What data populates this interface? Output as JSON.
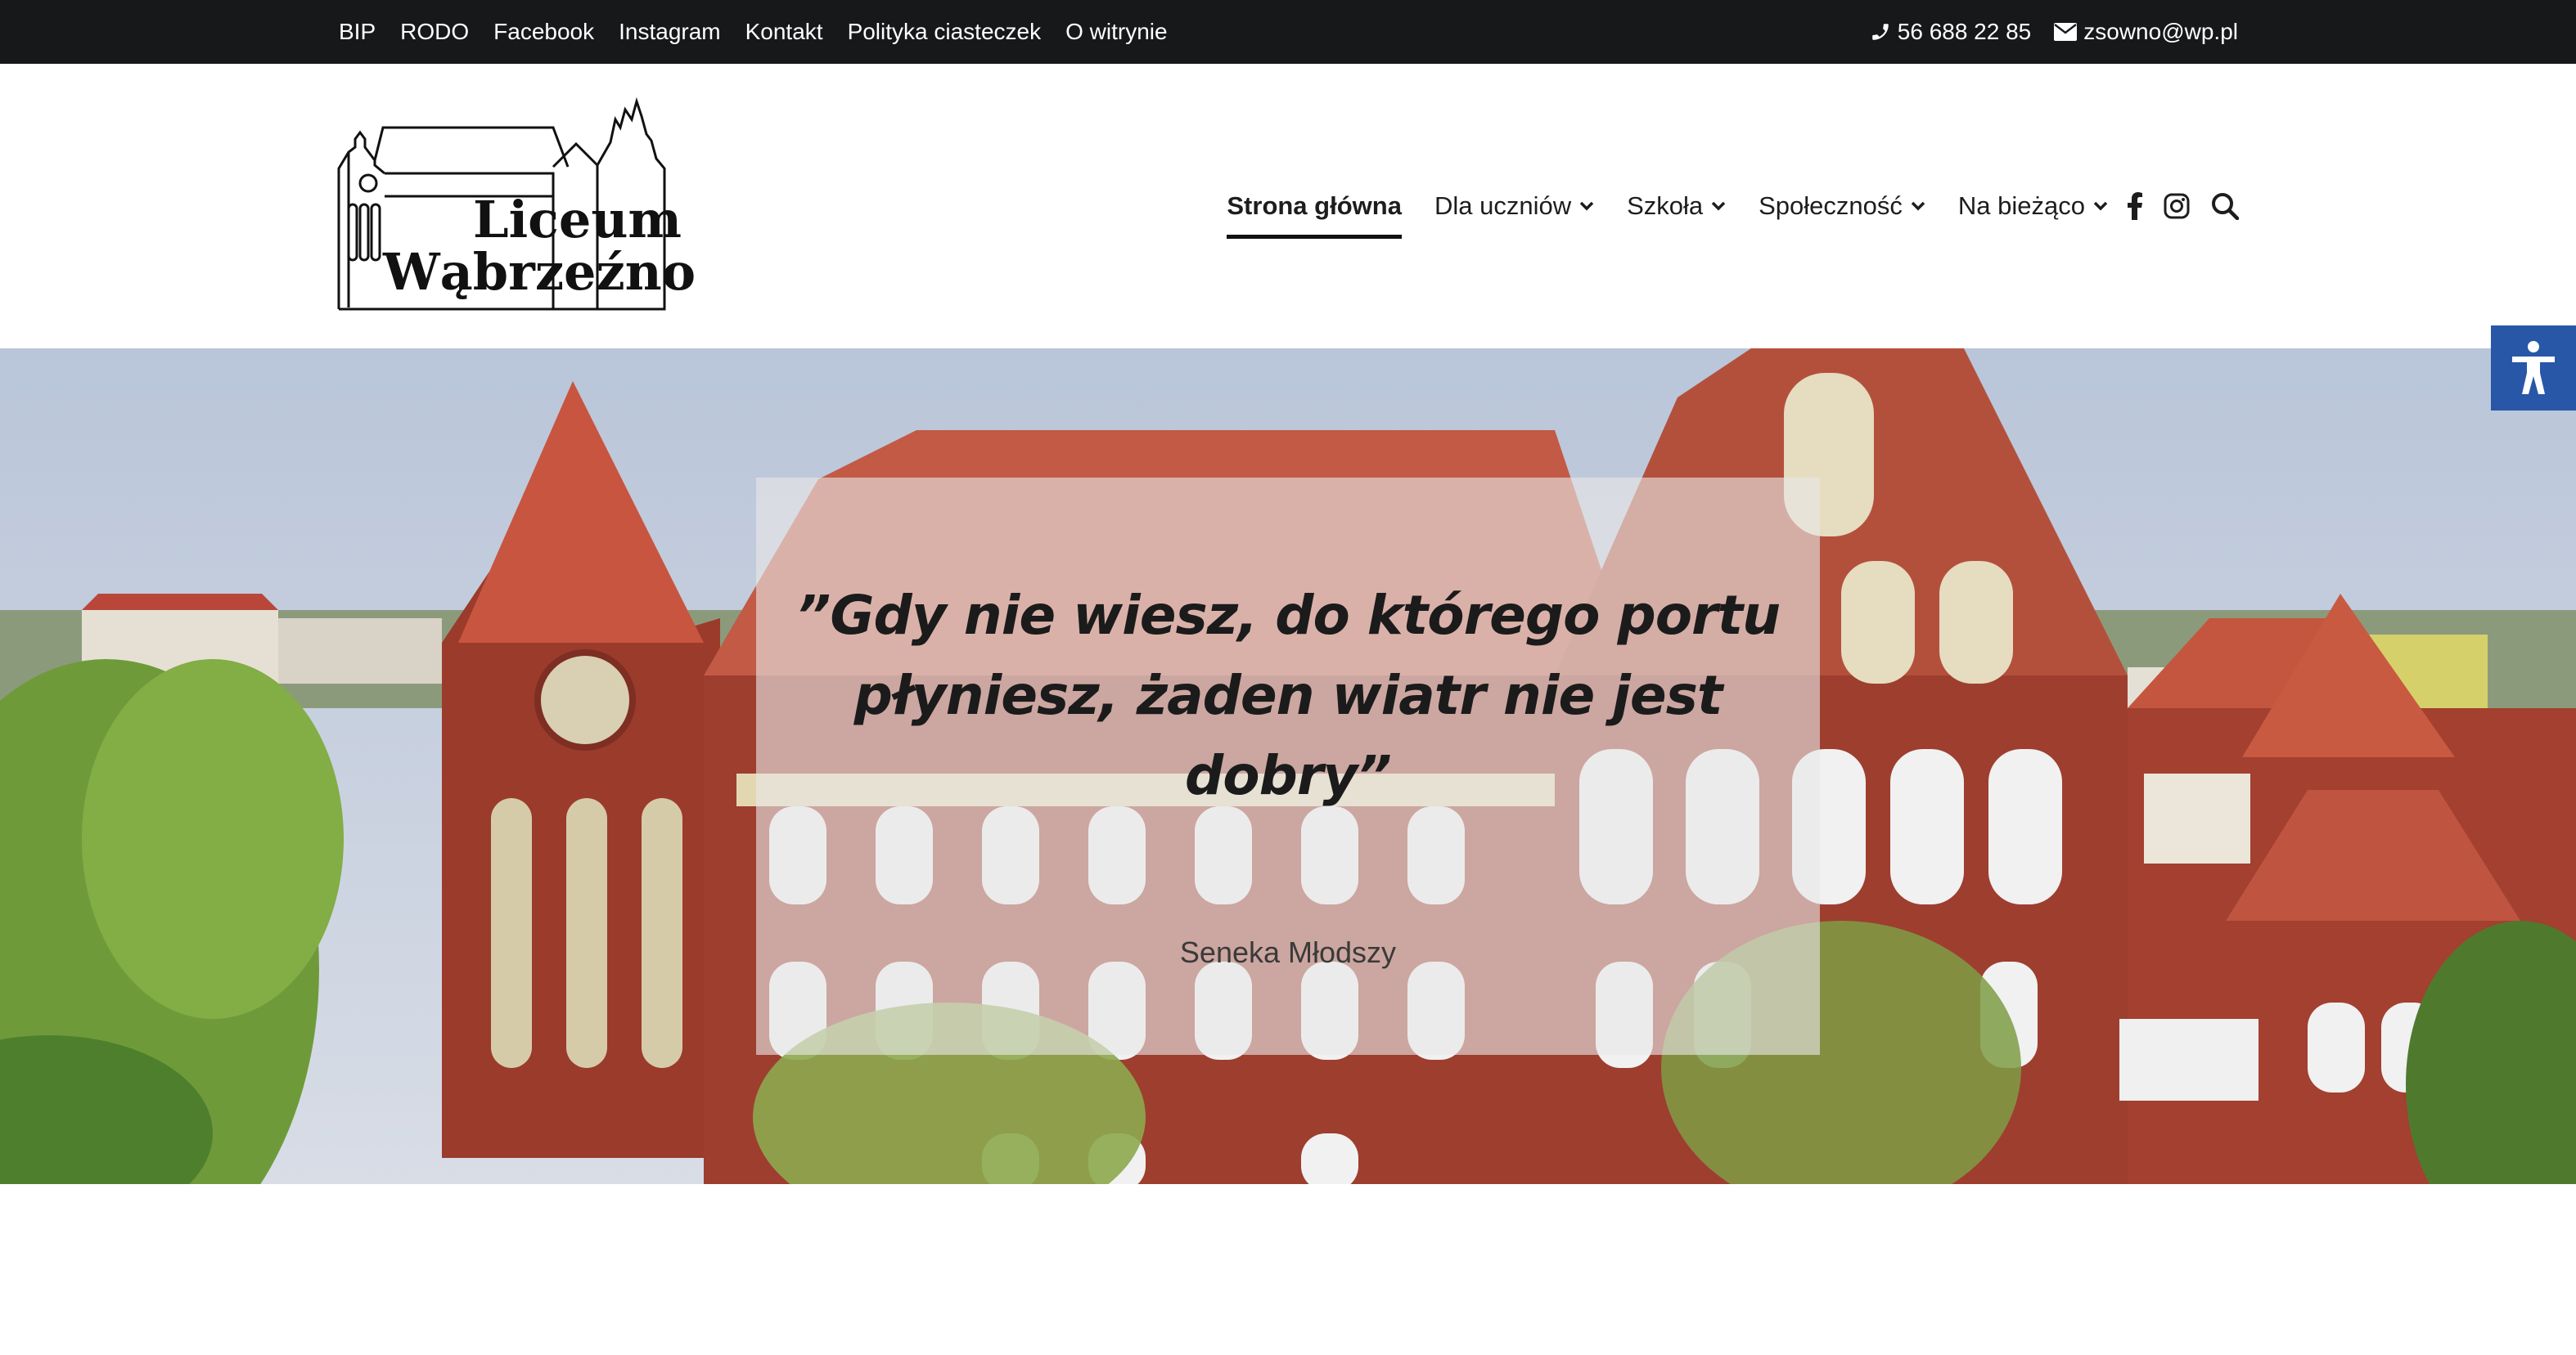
{
  "topbar": {
    "links": [
      "BIP",
      "RODO",
      "Facebook",
      "Instagram",
      "Kontakt",
      "Polityka ciasteczek",
      "O witrynie"
    ],
    "phone": "56 688 22 85",
    "email": "zsowno@wp.pl",
    "phone_icon": "phone-icon",
    "email_icon": "envelope-icon"
  },
  "logo": {
    "line1": "Liceum",
    "line2": "Wąbrzeźno"
  },
  "nav": {
    "items": [
      {
        "label": "Strona główna",
        "active": true,
        "dropdown": false
      },
      {
        "label": "Dla uczniów",
        "active": false,
        "dropdown": true
      },
      {
        "label": "Szkoła",
        "active": false,
        "dropdown": true
      },
      {
        "label": "Społeczność",
        "active": false,
        "dropdown": true
      },
      {
        "label": "Na bieżąco",
        "active": false,
        "dropdown": true
      }
    ],
    "icons": [
      "facebook-icon",
      "instagram-icon",
      "search-icon"
    ]
  },
  "accessibility": {
    "icon": "accessibility-icon",
    "color": "#2857a8"
  },
  "hero": {
    "quote_line1": "”Gdy nie wiesz, do którego portu",
    "quote_line2": "płyniesz, żaden wiatr nie jest dobry”",
    "author": "Seneka Młodszy"
  },
  "colors": {
    "topbar_bg": "#17181a",
    "brick": "#9b3b2c",
    "roof": "#c8553f"
  }
}
